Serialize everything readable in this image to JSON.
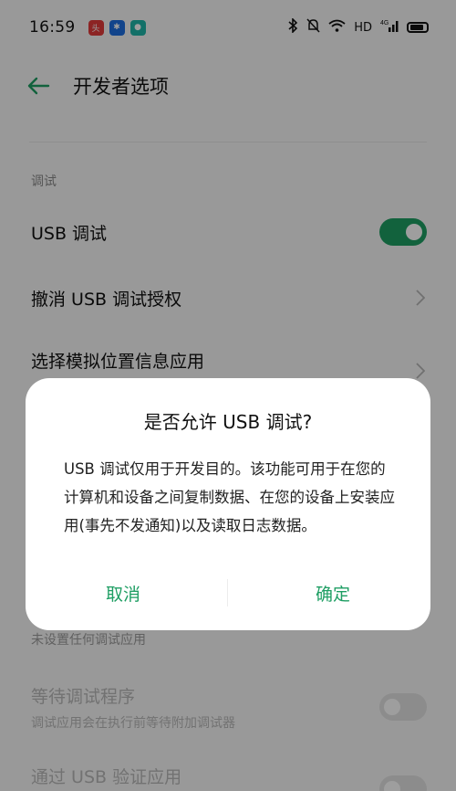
{
  "status_bar": {
    "time": "16:59",
    "network_label": "HD",
    "signal_label": "4G"
  },
  "app_bar": {
    "title": "开发者选项"
  },
  "settings": {
    "section_debug": "调试",
    "usb_debug_label": "USB 调试",
    "usb_debug_enabled": true,
    "revoke_label": "撤消 USB 调试授权",
    "mock_location_label": "选择模拟位置信息应用",
    "no_debug_app": "未设置任何调试应用",
    "wait_debugger_label": "等待调试程序",
    "wait_debugger_sub": "调试应用会在执行前等待附加调试器",
    "wait_debugger_enabled": false,
    "verify_usb_label": "通过 USB 验证应用"
  },
  "dialog": {
    "title": "是否允许 USB 调试?",
    "body": "USB 调试仅用于开发目的。该功能可用于在您的计算机和设备之间复制数据、在您的设备上安装应用(事先不发通知)以及读取日志数据。",
    "cancel_label": "取消",
    "ok_label": "确定"
  },
  "colors": {
    "accent": "#1e9e63",
    "background": "#f7f7f7",
    "scrim": "rgba(0,0,0,0.38)"
  }
}
